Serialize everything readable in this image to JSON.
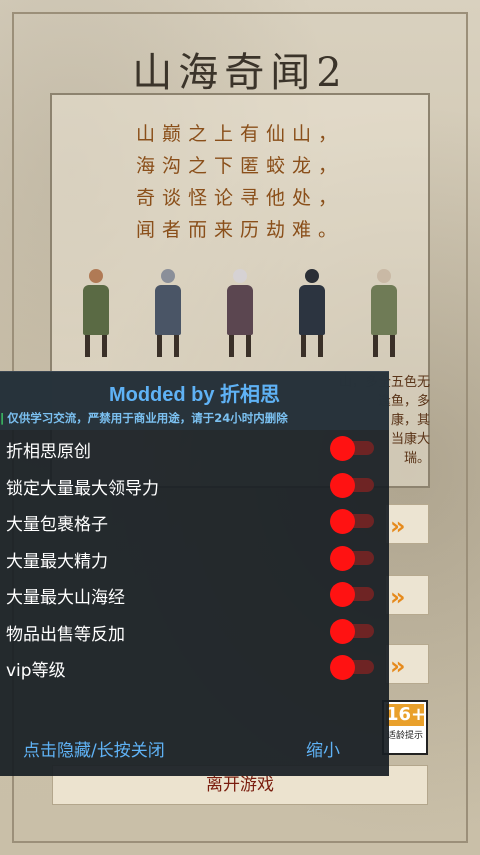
{
  "game": {
    "title": "山海奇闻2",
    "poem": [
      "山巅之上有仙山，",
      "海沟之下匿蛟龙，",
      "奇谈怪论寻他处，",
      "闻者而来历劫难。"
    ],
    "story_fragments": [
      "山，多全五色无",
      "逢鱼，多",
      "康，其",
      "当康大",
      "瑞。"
    ],
    "age_rating": "16+",
    "age_caption": "适龄提示",
    "exit_label": "离开游戏",
    "figure_colors": [
      "#5a6a44",
      "#4a5566",
      "#5b4650",
      "#2c3440",
      "#6f7b56"
    ]
  },
  "mod_menu": {
    "title": "Modded by 折相思",
    "notice": "仅供学习交流，严禁用于商业用途，请于24小时内删除",
    "options": [
      {
        "label": "折相思原创",
        "state": "on"
      },
      {
        "label": "锁定大量最大领导力",
        "state": "on"
      },
      {
        "label": "大量包裹格子",
        "state": "on"
      },
      {
        "label": "大量最大精力",
        "state": "on"
      },
      {
        "label": "大量最大山海经",
        "state": "on"
      },
      {
        "label": "物品出售等反加",
        "state": "on"
      },
      {
        "label": "vip等级",
        "state": "on"
      }
    ],
    "hide_close_label": "点击隐藏/长按关闭",
    "minimize_label": "缩小",
    "accent_color": "#5fb2f5",
    "switch_color": "#ff1212"
  }
}
